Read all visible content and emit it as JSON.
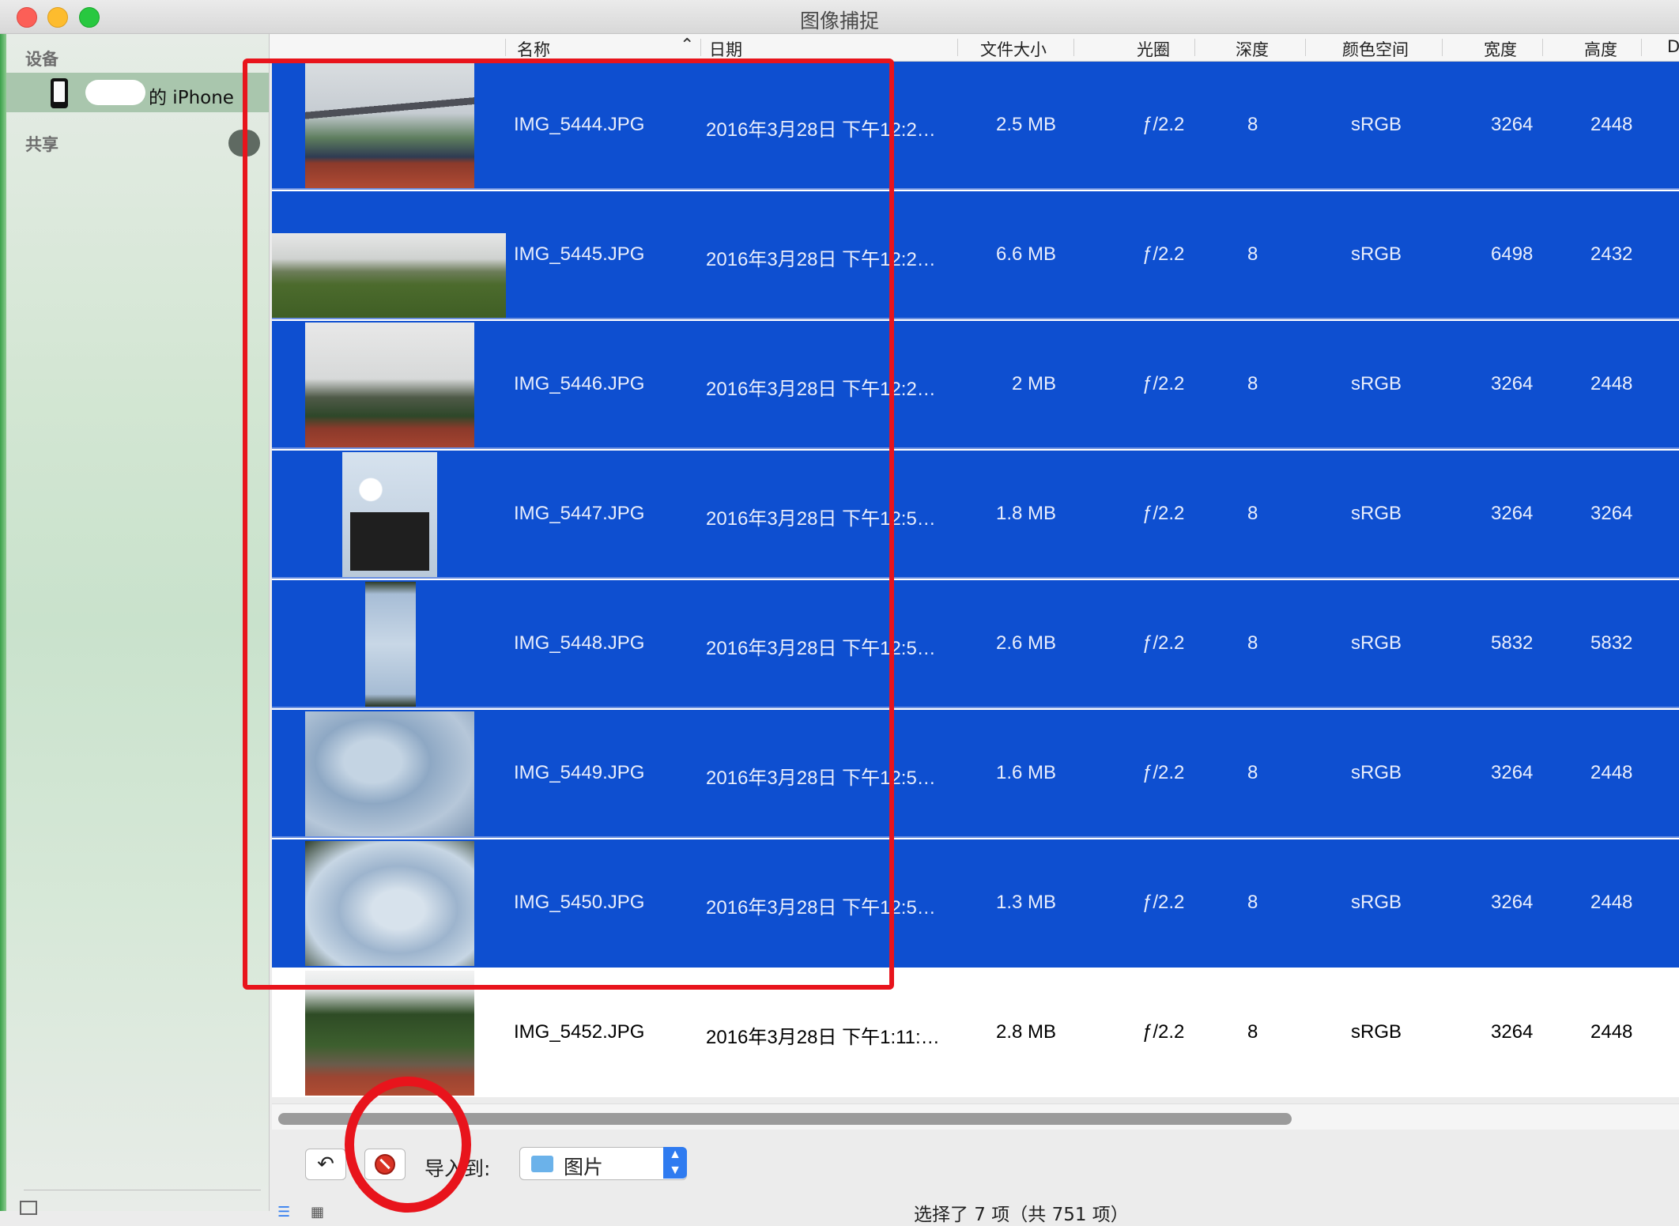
{
  "window": {
    "title": "图像捕捉"
  },
  "sidebar": {
    "devices_header": "设备",
    "device_name": "的 iPhone",
    "shared_header": "共享"
  },
  "table": {
    "headers": {
      "name": "名称",
      "date": "日期",
      "size": "文件大小",
      "aperture": "光圈",
      "depth": "深度",
      "colorspace": "颜色空间",
      "width": "宽度",
      "height": "高度",
      "more": "D"
    },
    "sort_indicator": "^",
    "rows": [
      {
        "name": "IMG_5444.JPG",
        "date": "2016年3月28日 下午12:2…",
        "size": "2.5 MB",
        "aperture": "ƒ/2.2",
        "depth": "8",
        "colorspace": "sRGB",
        "width": "3264",
        "height": "2448",
        "selected": true
      },
      {
        "name": "IMG_5445.JPG",
        "date": "2016年3月28日 下午12:2…",
        "size": "6.6 MB",
        "aperture": "ƒ/2.2",
        "depth": "8",
        "colorspace": "sRGB",
        "width": "6498",
        "height": "2432",
        "selected": true
      },
      {
        "name": "IMG_5446.JPG",
        "date": "2016年3月28日 下午12:2…",
        "size": "2 MB",
        "aperture": "ƒ/2.2",
        "depth": "8",
        "colorspace": "sRGB",
        "width": "3264",
        "height": "2448",
        "selected": true
      },
      {
        "name": "IMG_5447.JPG",
        "date": "2016年3月28日 下午12:5…",
        "size": "1.8 MB",
        "aperture": "ƒ/2.2",
        "depth": "8",
        "colorspace": "sRGB",
        "width": "3264",
        "height": "3264",
        "selected": true
      },
      {
        "name": "IMG_5448.JPG",
        "date": "2016年3月28日 下午12:5…",
        "size": "2.6 MB",
        "aperture": "ƒ/2.2",
        "depth": "8",
        "colorspace": "sRGB",
        "width": "5832",
        "height": "5832",
        "selected": true
      },
      {
        "name": "IMG_5449.JPG",
        "date": "2016年3月28日 下午12:5…",
        "size": "1.6 MB",
        "aperture": "ƒ/2.2",
        "depth": "8",
        "colorspace": "sRGB",
        "width": "3264",
        "height": "2448",
        "selected": true
      },
      {
        "name": "IMG_5450.JPG",
        "date": "2016年3月28日 下午12:5…",
        "size": "1.3 MB",
        "aperture": "ƒ/2.2",
        "depth": "8",
        "colorspace": "sRGB",
        "width": "3264",
        "height": "2448",
        "selected": true
      },
      {
        "name": "IMG_5452.JPG",
        "date": "2016年3月28日 下午1:11:…",
        "size": "2.8 MB",
        "aperture": "ƒ/2.2",
        "depth": "8",
        "colorspace": "sRGB",
        "width": "3264",
        "height": "2448",
        "selected": false
      }
    ]
  },
  "toolbar": {
    "import_label": "导入到:",
    "import_destination": "图片",
    "status": "选择了 7 项（共 751 项）"
  },
  "colors": {
    "selection": "#0e4fd0",
    "annotation": "#e8141c",
    "accent": "#2f7bf0"
  },
  "icons": [
    "phone-icon",
    "eject-icon",
    "rotate-icon",
    "delete-icon",
    "folder-icon",
    "list-view-icon",
    "grid-view-icon"
  ]
}
